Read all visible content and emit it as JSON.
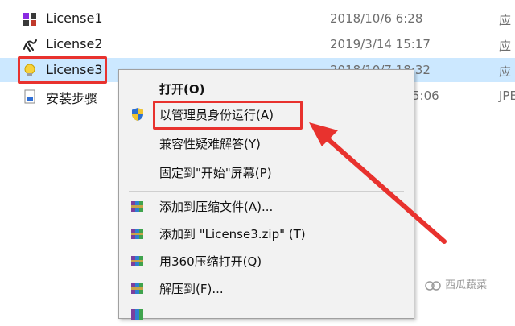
{
  "files": [
    {
      "name": "License1",
      "date": "2018/10/6 6:28",
      "type": "应",
      "icon": "colored-squares-icon",
      "selected": false
    },
    {
      "name": "License2",
      "date": "2019/3/14 15:17",
      "type": "应",
      "icon": "dragon-icon",
      "selected": false
    },
    {
      "name": "License3",
      "date": "2018/10/7 18:32",
      "type": "应",
      "icon": "lightbulb-icon",
      "selected": true
    },
    {
      "name": "安装步骤",
      "date": "5:06",
      "type": "JPE",
      "icon": "image-file-icon",
      "selected": false
    }
  ],
  "menu": {
    "items": [
      {
        "label": "打开(O)",
        "icon": "",
        "bold": true
      },
      {
        "label": "以管理员身份运行(A)",
        "icon": "uac-shield-icon",
        "bold": false
      },
      {
        "label": "兼容性疑难解答(Y)",
        "icon": "",
        "bold": false
      },
      {
        "label": "固定到\"开始\"屏幕(P)",
        "icon": "",
        "bold": false
      },
      {
        "label": "添加到压缩文件(A)...",
        "icon": "winrar-icon",
        "bold": false
      },
      {
        "label": "添加到 \"License3.zip\" (T)",
        "icon": "winrar-icon",
        "bold": false
      },
      {
        "label": "用360压缩打开(Q)",
        "icon": "winrar-icon",
        "bold": false
      },
      {
        "label": "解压到(F)...",
        "icon": "winrar-icon",
        "bold": false
      }
    ]
  },
  "annotation": {
    "color": "#e8322e"
  },
  "watermark": {
    "text": "西瓜蔬菜"
  }
}
